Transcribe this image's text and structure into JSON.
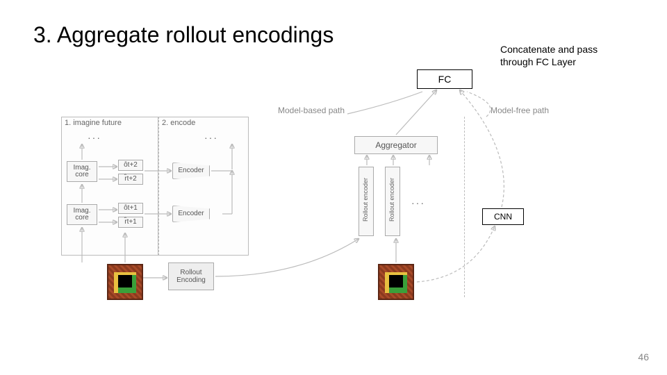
{
  "title": "3. Aggregate rollout encodings",
  "fc_label": "FC",
  "caption": "Concatenate and pass through FC Layer",
  "cnn_label": "CNN",
  "page_number": "46",
  "panel1_title": "1. imagine future",
  "panel2_title": "2. encode",
  "imag_core": "Imag.\ncore",
  "obs_t2": "ôt+2",
  "rew_t2": "r̂t+2",
  "obs_t1": "ôt+1",
  "rew_t1": "r̂t+1",
  "encoder": "Encoder",
  "rollout_enc": "Rollout\nEncoding",
  "aggregator": "Aggregator",
  "rollout_vert": "Rollout encoder",
  "mb_path": "Model-based path",
  "mf_path": "Model-free path",
  "dots": "···"
}
